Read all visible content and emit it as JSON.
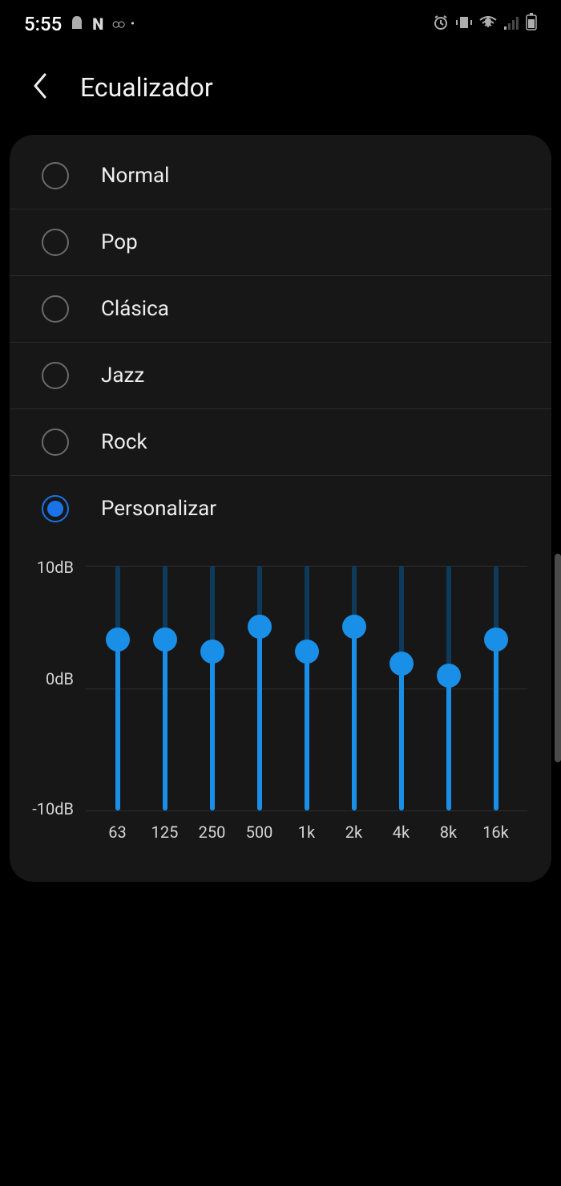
{
  "status_bar": {
    "time": "5:55"
  },
  "header": {
    "title": "Ecualizador"
  },
  "presets": [
    {
      "label": "Normal",
      "selected": false
    },
    {
      "label": "Pop",
      "selected": false
    },
    {
      "label": "Clásica",
      "selected": false
    },
    {
      "label": "Jazz",
      "selected": false
    },
    {
      "label": "Rock",
      "selected": false
    },
    {
      "label": "Personalizar",
      "selected": true
    }
  ],
  "chart_data": {
    "type": "equalizer",
    "y_labels": [
      "10dB",
      "0dB",
      "-10dB"
    ],
    "ylim": [
      -10,
      10
    ],
    "bands": [
      {
        "freq": "63",
        "value": 4
      },
      {
        "freq": "125",
        "value": 4
      },
      {
        "freq": "250",
        "value": 3
      },
      {
        "freq": "500",
        "value": 5
      },
      {
        "freq": "1k",
        "value": 3
      },
      {
        "freq": "2k",
        "value": 5
      },
      {
        "freq": "4k",
        "value": 2
      },
      {
        "freq": "8k",
        "value": 1
      },
      {
        "freq": "16k",
        "value": 4
      }
    ]
  }
}
